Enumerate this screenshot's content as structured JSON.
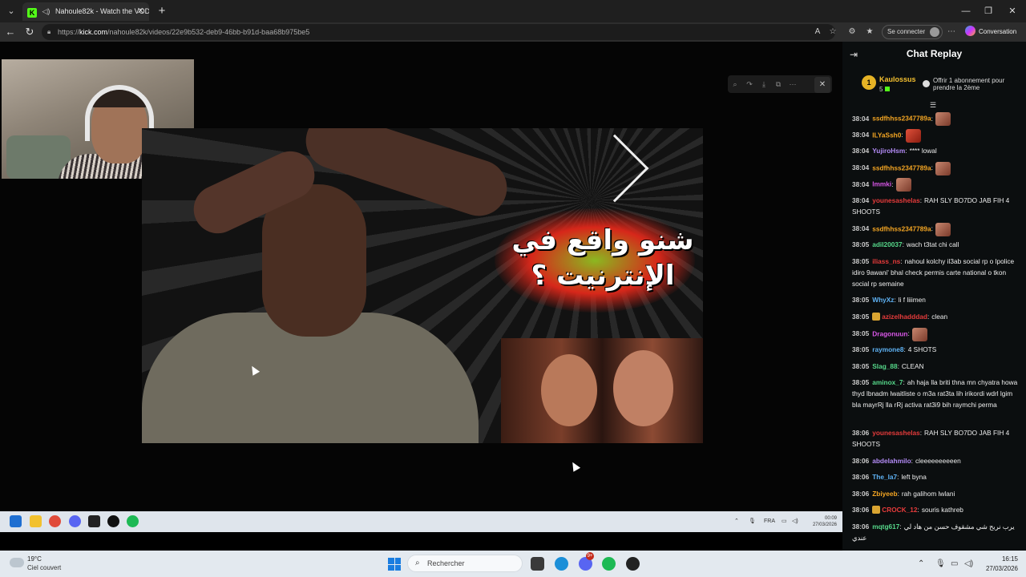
{
  "browser": {
    "tab_title": "Nahoule82k - Watch the VOD",
    "favicon_letter": "K",
    "url_prefix": "https://",
    "url_host": "kick.com",
    "url_path": "/nahoule82k/videos/22e9b532-deb9-46bb-b91d-baa68b975be5",
    "signin_label": "Se connecter",
    "copilot_label": "Conversation"
  },
  "thumbnail": {
    "title_line1": "شنو واقع في",
    "title_line2": "الإنترنيت ؟"
  },
  "inner_taskbar": {
    "lang": "FRA",
    "time": "00:09",
    "date": "27/03/2026"
  },
  "chat": {
    "title": "Chat Replay",
    "pinned": {
      "rank": "1",
      "user": "Kaulossus",
      "count": "5",
      "offer": "Offrir 1 abonnement pour prendre la 2ème"
    },
    "messages": [
      {
        "time": "38:04",
        "user": "ssdfhhss2347789a",
        "color": "#f5a623",
        "sep": ":",
        "text": "",
        "emote": true,
        "emote_style": "",
        "badge": false
      },
      {
        "time": "38:04",
        "user": "ILYaSsh0",
        "color": "#f5a623",
        "sep": ":",
        "text": "",
        "emote": true,
        "emote_style": "red",
        "badge": false
      },
      {
        "time": "38:04",
        "user": "YujiroHsm",
        "color": "#b48cf7",
        "sep": ":",
        "text": "**** lowal",
        "emote": false,
        "badge": false
      },
      {
        "time": "38:04",
        "user": "ssdfhhss2347789a",
        "color": "#f5a623",
        "sep": ":",
        "text": "",
        "emote": true,
        "emote_style": "",
        "badge": false
      },
      {
        "time": "38:04",
        "user": "lmmki",
        "color": "#d957e8",
        "sep": ":",
        "text": "",
        "emote": true,
        "emote_style": "",
        "badge": false
      },
      {
        "time": "38:04",
        "user": "younesashelas",
        "color": "#e63b3b",
        "sep": ":",
        "text": "RAH SLY BO7DO JAB FIH 4 SHOOTS",
        "emote": false,
        "badge": false
      },
      {
        "time": "38:04",
        "user": "ssdfhhss2347789a",
        "color": "#f5a623",
        "sep": ":",
        "text": "",
        "emote": true,
        "emote_style": "",
        "badge": false
      },
      {
        "time": "38:05",
        "user": "adil20037",
        "color": "#56d88a",
        "sep": ":",
        "text": "wach t3tat chi call",
        "emote": false,
        "badge": false
      },
      {
        "time": "38:05",
        "user": "iliass_ns",
        "color": "#e63b3b",
        "sep": ":",
        "text": "nahoul kolchy il3ab social rp o lpolice idiro 9awani' bhal check permis carte national o tkon social rp semaine",
        "emote": false,
        "badge": false
      },
      {
        "time": "38:05",
        "user": "WhyXz",
        "color": "#5fb3f5",
        "sep": ":",
        "text": "li f liiimen",
        "emote": false,
        "badge": false
      },
      {
        "time": "38:05",
        "user": "azizelhadddad",
        "color": "#e63b3b",
        "sep": ":",
        "text": "clean",
        "emote": false,
        "badge": true
      },
      {
        "time": "38:05",
        "user": "Dragonuun",
        "color": "#d957e8",
        "sep": ":",
        "text": "",
        "emote": true,
        "emote_style": "",
        "badge": false
      },
      {
        "time": "38:05",
        "user": "raymone8",
        "color": "#5fb3f5",
        "sep": ":",
        "text": "4 SHOTS",
        "emote": false,
        "badge": false
      },
      {
        "time": "38:05",
        "user": "Slag_88",
        "color": "#56d88a",
        "sep": ":",
        "text": "CLEAN",
        "emote": false,
        "badge": false
      },
      {
        "time": "38:05",
        "user": "aminox_7",
        "color": "#56d88a",
        "sep": ":",
        "text": "ah haja lla briti thna mn chyatra howa thyd lbnadm lwaitliste o m3a rat3ta lih irikordi wdrl lgim bla mayrRj lla rRj activa rat3i9 bih raymchi perma",
        "emote": false,
        "badge": false
      },
      {
        "time": "38:06",
        "user": "younesashelas",
        "color": "#e63b3b",
        "sep": ":",
        "text": "RAH SLY BO7DO JAB FIH 4 SHOOTS",
        "emote": false,
        "badge": false
      },
      {
        "time": "38:06",
        "user": "abdelahmilo",
        "color": "#b48cf7",
        "sep": ":",
        "text": "cleeeeeeeeeen",
        "emote": false,
        "badge": false
      },
      {
        "time": "38:06",
        "user": "The_la7",
        "color": "#5fb3f5",
        "sep": ":",
        "text": "left byna",
        "emote": false,
        "badge": false
      },
      {
        "time": "38:06",
        "user": "Zbiyeeb",
        "color": "#f5a623",
        "sep": ":",
        "text": "rah galihom lwlani",
        "emote": false,
        "badge": false
      },
      {
        "time": "38:06",
        "user": "CROCK_12",
        "color": "#e63b3b",
        "sep": ":",
        "text": "souris kathreb",
        "emote": false,
        "badge": true
      },
      {
        "time": "38:06",
        "user": "mqtg617",
        "color": "#56d88a",
        "sep": ":",
        "text": "يرب نربح شي مشقوف حسن من هاد لي عندي",
        "emote": false,
        "badge": false
      }
    ]
  },
  "os": {
    "temp": "19°C",
    "condition": "Ciel couvert",
    "search_placeholder": "Rechercher",
    "notif_badge": "9+",
    "time": "16:15",
    "date": "27/03/2026"
  },
  "colors": {
    "kick_green": "#53fc18",
    "chat_bg": "#0b0e0f",
    "taskbar": "#e3e9ef"
  }
}
